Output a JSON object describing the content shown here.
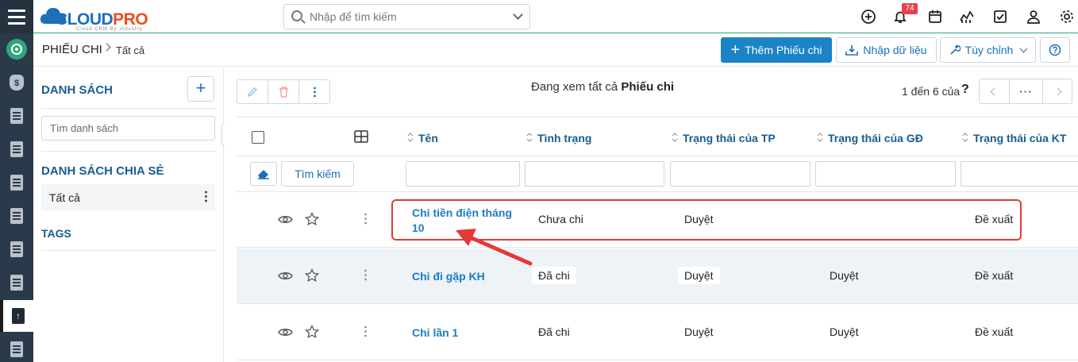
{
  "app": {
    "brand_cloud": "CLOUD",
    "brand_pro": "PRO",
    "tagline": "Cloud CRM By Industry"
  },
  "search": {
    "placeholder": "Nhập để tìm kiếm"
  },
  "topbar": {
    "notification_count": "74"
  },
  "breadcrumb": {
    "module": "PHIẾU CHI",
    "view": "Tất cả"
  },
  "actions": {
    "add_label": "Thêm Phiếu chi",
    "import_label": "Nhập dữ liệu",
    "customize_label": "Tùy chỉnh"
  },
  "sidebar": {
    "list_title": "DANH SÁCH",
    "search_placeholder": "Tìm danh sách",
    "shared_title": "DANH SÁCH CHIA SẺ",
    "shared_items": [
      {
        "label": "Tất cả"
      }
    ],
    "tags_title": "TAGS"
  },
  "listview": {
    "viewing_prefix": "Đang xem tất cả",
    "viewing_module": "Phiếu chi",
    "paging": "1 đến 6 của",
    "help": "?",
    "search_button": "Tìm kiếm",
    "columns": [
      "Tên",
      "Tình trạng",
      "Trạng thái của TP",
      "Trạng thái của GĐ",
      "Trạng thái của KT"
    ],
    "rows": [
      {
        "name_line1": "Chi tiền điện tháng",
        "name_line2": "10",
        "status": "Chưa chi",
        "tp": "Duyệt",
        "gd": "",
        "kt": "Đề xuất"
      },
      {
        "name_line1": "Chi đi gặp KH",
        "name_line2": "",
        "status": "Đã chi",
        "tp": "Duyệt",
        "gd": "Duyệt",
        "kt": "Đề xuất"
      },
      {
        "name_line1": "Chi lần 1",
        "name_line2": "",
        "status": "Đã chi",
        "tp": "Duyệt",
        "gd": "Duyệt",
        "kt": "Đề xuất"
      }
    ]
  },
  "colors": {
    "accent": "#1a84c7",
    "link": "#1c7cc1",
    "heading": "#1a5d8f",
    "highlight": "#e53935",
    "rail": "#2b3a4a"
  }
}
